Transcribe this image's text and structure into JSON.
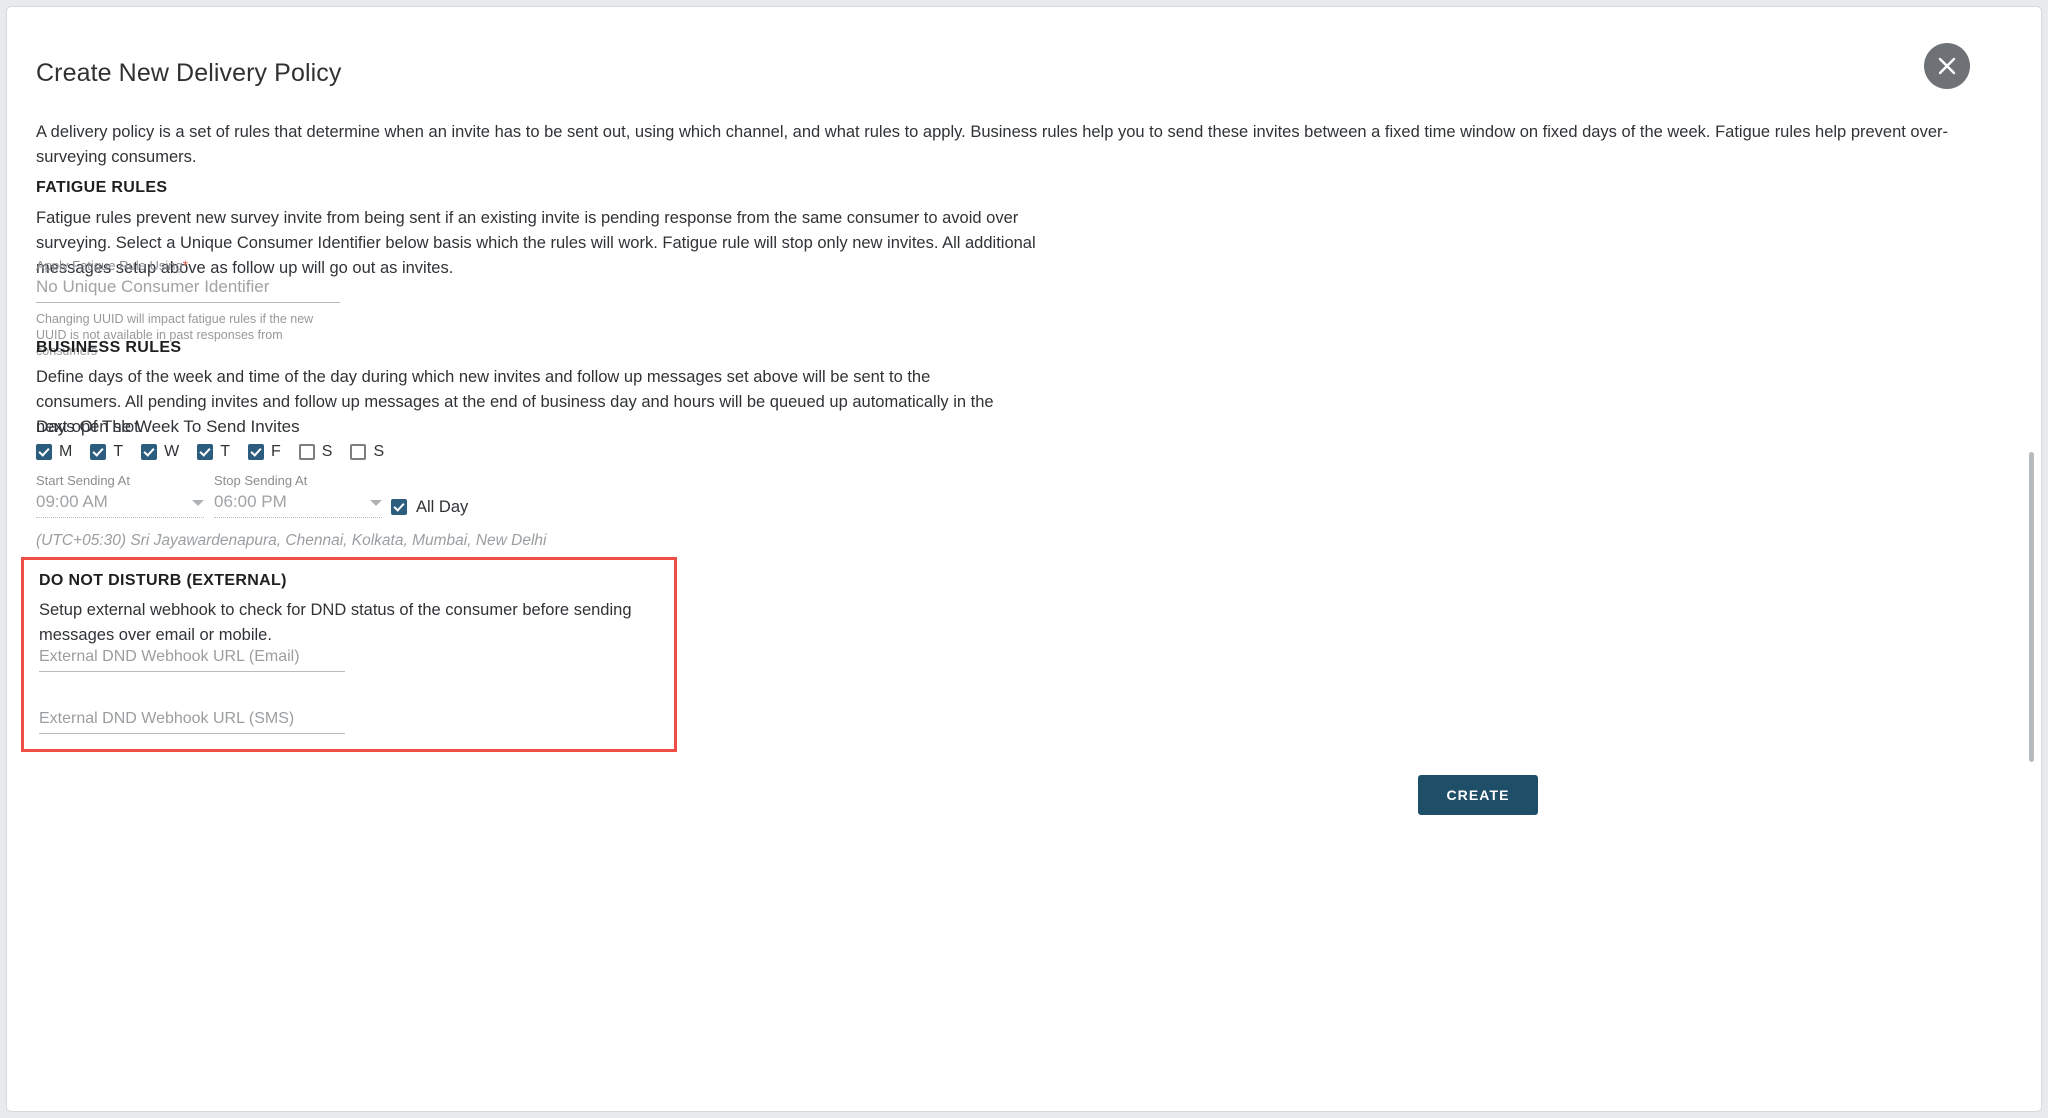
{
  "dialog": {
    "title": "Create New Delivery Policy",
    "close_icon": "close-icon",
    "intro": "A delivery policy is a set of rules that determine when an invite has to be sent out, using which channel, and what rules to apply. Business rules help you to send these invites between a fixed time window on fixed days of the week. Fatigue rules help prevent over-surveying consumers."
  },
  "fatigue": {
    "heading": "FATIGUE RULES",
    "description": "Fatigue rules prevent new survey invite from being sent if an existing invite is pending response from the same consumer to avoid over surveying. Select a Unique Consumer Identifier below basis which the rules will work. Fatigue rule will stop only new invites. All additional messages setup above as follow up will go out as invites.",
    "field_label": "Apply Fatigue Rule Using",
    "required_marker": "*",
    "field_value": "No Unique Consumer Identifier",
    "hint": "Changing UUID will impact fatigue rules if the new UUID is not available in past responses from consumers"
  },
  "business": {
    "heading": "BUSINESS RULES",
    "description": "Define days of the week and time of the day during which new invites and follow up messages set above will be sent to the consumers. All pending invites and follow up messages at the end of business day and hours will be queued up automatically in the next open slot.",
    "days_label": "Days Of The Week To Send Invites",
    "days": [
      {
        "letter": "M",
        "checked": true
      },
      {
        "letter": "T",
        "checked": true
      },
      {
        "letter": "W",
        "checked": true
      },
      {
        "letter": "T",
        "checked": true
      },
      {
        "letter": "F",
        "checked": true
      },
      {
        "letter": "S",
        "checked": false
      },
      {
        "letter": "S",
        "checked": false
      }
    ],
    "start_label": "Start Sending At",
    "start_value": "09:00 AM",
    "stop_label": "Stop Sending At",
    "stop_value": "06:00 PM",
    "all_day_label": "All Day",
    "all_day_checked": true,
    "timezone": "(UTC+05:30) Sri Jayawardenapura, Chennai, Kolkata, Mumbai, New Delhi"
  },
  "dnd": {
    "heading": "DO NOT DISTURB (EXTERNAL)",
    "description": "Setup external webhook to check for DND status of the consumer before sending messages over email or mobile.",
    "email_placeholder": "External DND Webhook URL (Email)",
    "email_value": "",
    "sms_placeholder": "External DND Webhook URL (SMS)",
    "sms_value": "",
    "highlight_color": "#ef4d45"
  },
  "footer": {
    "create_label": "CREATE"
  },
  "colors": {
    "accent": "#2c5d7e",
    "primary_button": "#1f4e68",
    "required": "#e8614d",
    "close_button": "#6e7277"
  }
}
